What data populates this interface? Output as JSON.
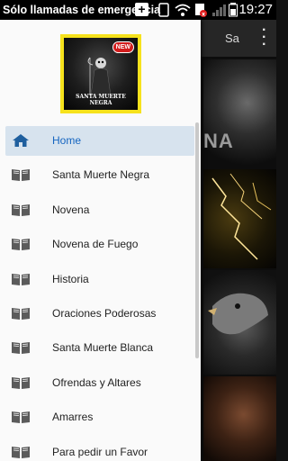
{
  "status_bar": {
    "carrier": "Sólo llamadas de emergencia",
    "time": "19:27"
  },
  "background": {
    "toolbar_title": "Sa",
    "tile_text": "NA"
  },
  "drawer": {
    "logo": {
      "badge": "NEW",
      "caption": "SANTA MUERTE NEGRA"
    },
    "items": [
      {
        "label": "Home",
        "icon": "home-icon",
        "active": true
      },
      {
        "label": "Santa Muerte Negra",
        "icon": "book-icon"
      },
      {
        "label": "Novena",
        "icon": "book-icon"
      },
      {
        "label": "Novena de Fuego",
        "icon": "book-icon"
      },
      {
        "label": "Historia",
        "icon": "book-icon"
      },
      {
        "label": "Oraciones Poderosas",
        "icon": "book-icon"
      },
      {
        "label": "Santa Muerte Blanca",
        "icon": "book-icon"
      },
      {
        "label": "Ofrendas y Altares",
        "icon": "book-icon"
      },
      {
        "label": "Amarres",
        "icon": "book-icon"
      },
      {
        "label": "Para pedir un Favor",
        "icon": "book-icon"
      }
    ]
  },
  "colors": {
    "active_label": "#1565c0",
    "active_bg": "#d7e3ee",
    "icon": "#5b5b5b",
    "home_icon": "#1f5f9e"
  }
}
